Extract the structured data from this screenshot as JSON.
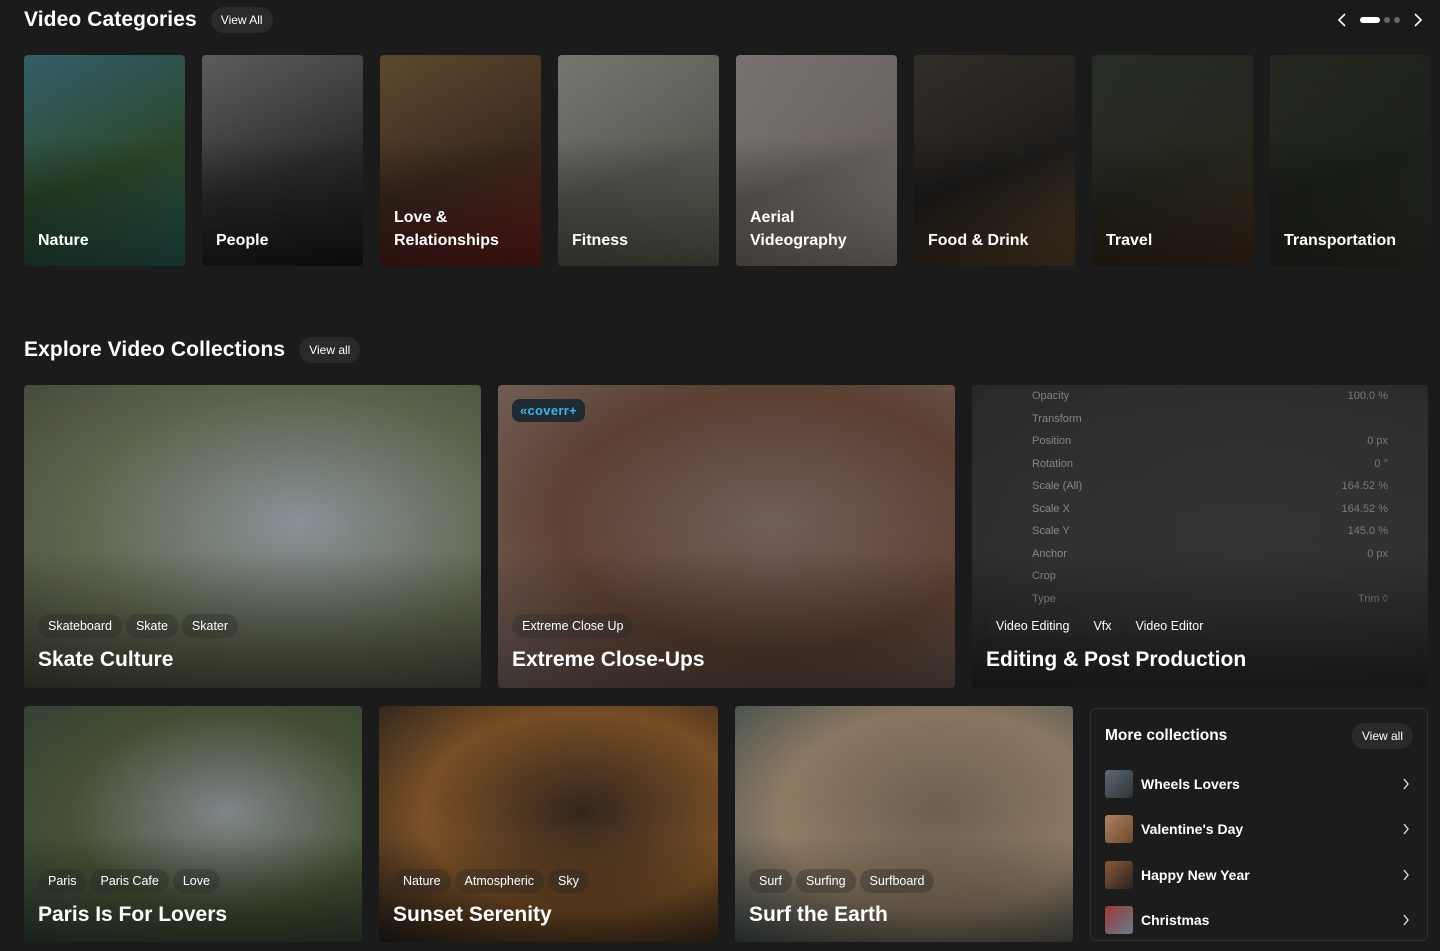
{
  "categories_section": {
    "title": "Video Categories",
    "view_all": "View All"
  },
  "carousel": {
    "pages": 3,
    "active_page": 1
  },
  "categories": [
    {
      "label": "Nature",
      "colors": [
        "#3c6e7c",
        "#2c4a2a",
        "#2f6b63"
      ]
    },
    {
      "label": "People",
      "colors": [
        "#6c6c6c",
        "#2e2e2e",
        "#1c1c1c"
      ]
    },
    {
      "label": "Love & Relationships",
      "colors": [
        "#6d5436",
        "#3c2a1e",
        "#7a2020"
      ]
    },
    {
      "label": "Fitness",
      "colors": [
        "#8a8a84",
        "#5c5b54",
        "#6e6a5e"
      ]
    },
    {
      "label": "Aerial Videography",
      "colors": [
        "#8c8684",
        "#6c6563",
        "#a8a09a"
      ]
    },
    {
      "label": "Food & Drink",
      "colors": [
        "#3a3530",
        "#1f1d1b",
        "#6a4e30"
      ]
    },
    {
      "label": "Travel",
      "colors": [
        "#2f342e",
        "#26291f",
        "#4a3222"
      ]
    },
    {
      "label": "Transportation",
      "colors": [
        "#2a2e26",
        "#1e221c",
        "#353a30"
      ]
    }
  ],
  "collections_section": {
    "title": "Explore Video Collections",
    "view_all": "View all"
  },
  "collections": [
    {
      "title": "Skate Culture",
      "tags": [
        "Skateboard",
        "Skate",
        "Skater"
      ],
      "colors": [
        "#9aa3ab",
        "#6b7358",
        "#4d5342"
      ]
    },
    {
      "title": "Extreme Close-Ups",
      "tags": [
        "Extreme Close Up"
      ],
      "badge": "«coverr+",
      "colors": [
        "#7e6a64",
        "#6a4a3a",
        "#8a7670"
      ]
    },
    {
      "title": "Editing & Post Production",
      "tags": [
        "Video Editing",
        "Vfx",
        "Video Editor"
      ],
      "colors": [
        "#3a3a3a",
        "#363636",
        "#2e2e2e"
      ],
      "panel": [
        {
          "k": "Opacity",
          "v": "100.0 %"
        },
        {
          "k": "Transform",
          "v": ""
        },
        {
          "k": "Position",
          "v": "0 px"
        },
        {
          "k": "Rotation",
          "v": "0 °"
        },
        {
          "k": "Scale (All)",
          "v": "164.52 %"
        },
        {
          "k": "Scale X",
          "v": "164.52 %"
        },
        {
          "k": "Scale Y",
          "v": "145.0 %"
        },
        {
          "k": "Anchor",
          "v": "0 px"
        },
        {
          "k": "Crop",
          "v": ""
        },
        {
          "k": "Type",
          "v": "Trim ◊"
        }
      ]
    },
    {
      "title": "Paris Is For Lovers",
      "tags": [
        "Paris",
        "Paris Cafe",
        "Love"
      ],
      "colors": [
        "#8f969a",
        "#4e5a3a",
        "#3a4a40"
      ]
    },
    {
      "title": "Sunset Serenity",
      "tags": [
        "Nature",
        "Atmospheric",
        "Sky"
      ],
      "colors": [
        "#3a2a20",
        "#8a5a2a",
        "#2a2420"
      ]
    },
    {
      "title": "Surf the Earth",
      "tags": [
        "Surf",
        "Surfing",
        "Surfboard"
      ],
      "colors": [
        "#7a6a58",
        "#a08a70",
        "#4a5a5a"
      ]
    }
  ],
  "more_collections": {
    "title": "More collections",
    "view_all": "View all",
    "items": [
      {
        "label": "Wheels Lovers",
        "colors": [
          "#5c6a74",
          "#2e3236"
        ]
      },
      {
        "label": "Valentine's Day",
        "colors": [
          "#b08060",
          "#6a4a30"
        ]
      },
      {
        "label": "Happy New Year",
        "colors": [
          "#8a5a3a",
          "#2a2020"
        ]
      },
      {
        "label": "Christmas",
        "colors": [
          "#9a3a3a",
          "#6a7a8a"
        ]
      }
    ]
  }
}
